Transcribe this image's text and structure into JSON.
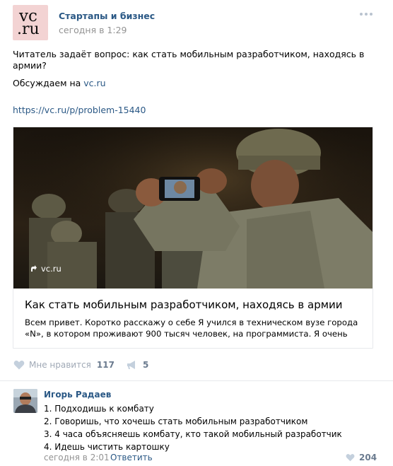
{
  "post": {
    "logo_line1": "vc",
    "logo_line2": ".ru",
    "author": "Стартапы и бизнес",
    "date": "сегодня в 1:29",
    "text_line1": "Читатель задаёт вопрос: как стать мобильным разработчиком, находясь в армии?",
    "text_line2_prefix": "Обсуждаем на ",
    "text_line2_link": "vc.ru",
    "url": "https://vc.ru/p/problem-15440"
  },
  "card": {
    "source": "vc.ru",
    "title": "Как стать мобильным разработчиком, находясь в армии",
    "description": "Всем привет. Коротко расскажу о себе Я учился в техническом вузе города «N», в котором проживают 900 тысяч человек, на программиста. Я очень"
  },
  "actions": {
    "like_label": "Мне нравится",
    "like_count": "117",
    "share_count": "5"
  },
  "comment": {
    "author": "Игорь Радаев",
    "lines": [
      "1. Подходишь к комбату",
      "2. Говоришь, что хочешь стать мобильным разработчиком",
      "3. 4 часа объясняешь комбату, кто такой мобильный разработчик",
      "4. Идешь чистить картошку"
    ],
    "date": "сегодня в 2:01",
    "reply_label": "Ответить",
    "like_count": "204"
  },
  "colors": {
    "link": "#2a5885",
    "muted": "#939393",
    "logo_bg": "#f3d3d3"
  },
  "icons": {
    "like": "heart-icon",
    "share": "megaphone-icon",
    "more": "more-dots-icon",
    "source": "arrow-icon"
  }
}
